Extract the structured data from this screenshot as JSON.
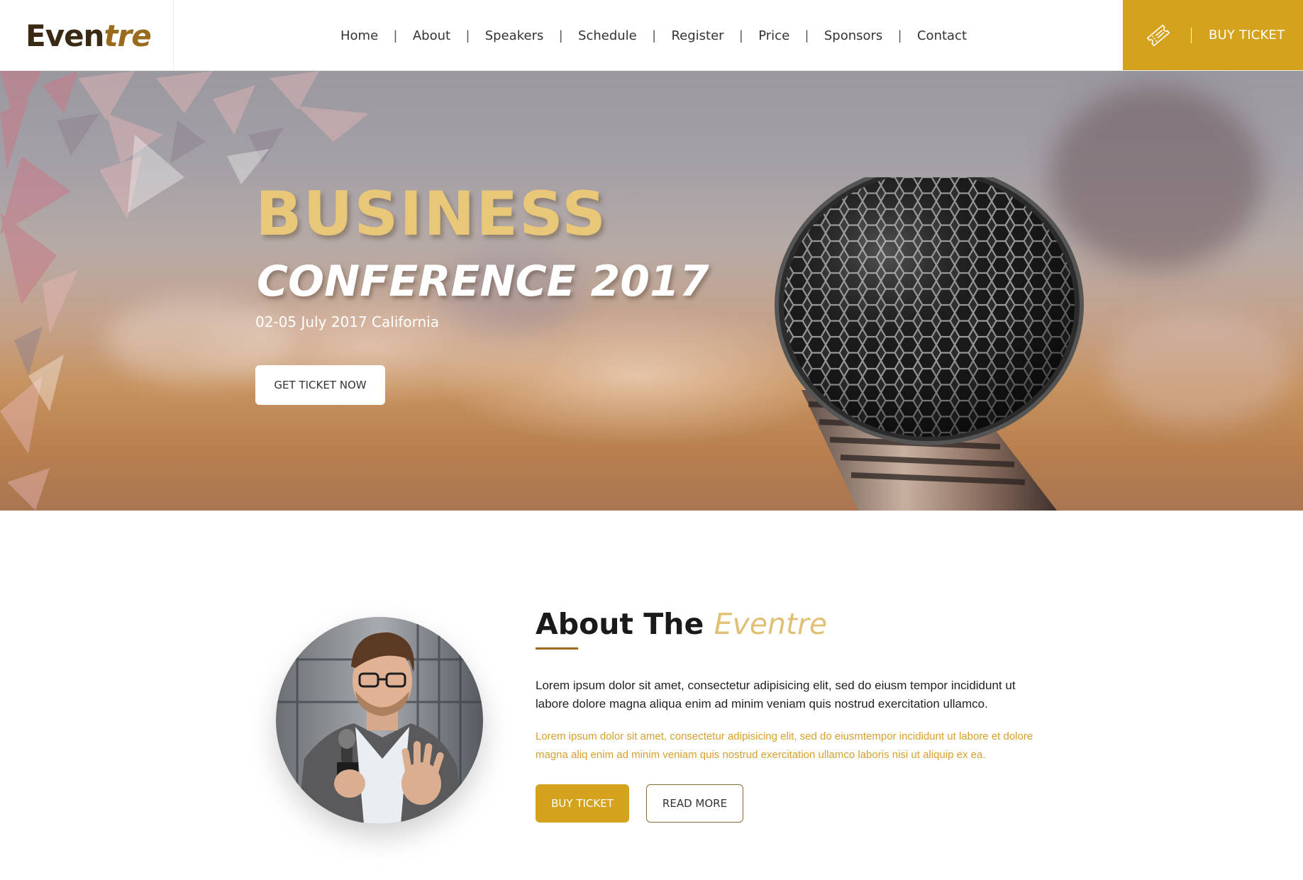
{
  "brand": {
    "logo_main": "Even",
    "logo_accent": "tre"
  },
  "nav": {
    "items": [
      "Home",
      "About",
      "Speakers",
      "Schedule",
      "Register",
      "Price",
      "Sponsors",
      "Contact"
    ],
    "separator": "|"
  },
  "header_cta": {
    "label": "BUY TICKET",
    "icon": "ticket-icon"
  },
  "hero": {
    "title": "BUSINESS",
    "subtitle": "CONFERENCE 2017",
    "date_location": "02-05 July 2017 California",
    "cta_label": "GET TICKET NOW"
  },
  "about": {
    "title_plain": "About The",
    "title_accent": "Eventre",
    "paragraph_1": "Lorem ipsum dolor sit amet, consectetur adipisicing elit, sed do eiusm tempor incididunt ut labore dolore magna aliqua enim ad minim veniam quis nostrud exercitation ullamco.",
    "paragraph_2": "Lorem ipsum dolor sit amet, consectetur adipisicing elit, sed do eiusmtempor incididunt ut labore et dolore magna aliq enim ad minim veniam quis nostrud exercitation ullamco laboris nisi ut aliquip ex ea.",
    "buy_label": "BUY TICKET",
    "read_more_label": "READ MORE"
  },
  "colors": {
    "accent_gold": "#d4a21c",
    "title_gold": "#e8c878",
    "text_gold": "#d69f2e",
    "brand_brown": "#3a2a14"
  }
}
